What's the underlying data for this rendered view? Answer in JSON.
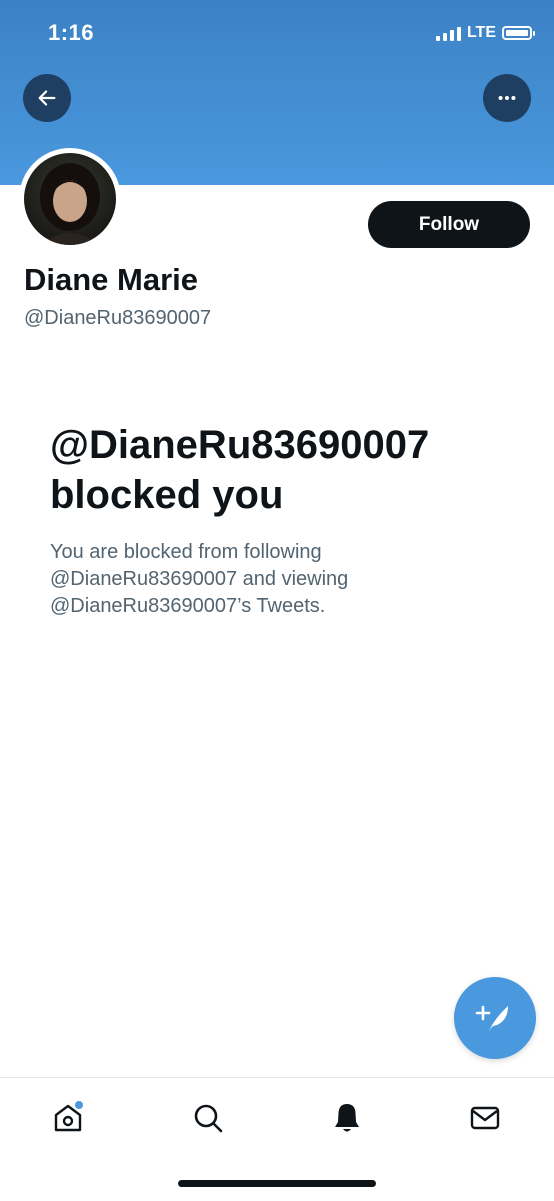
{
  "status_bar": {
    "time": "1:16",
    "network": "LTE",
    "icons": [
      "signal-icon",
      "battery-icon"
    ]
  },
  "header": {
    "back_icon": "arrow-left-icon",
    "more_icon": "more-horizontal-icon"
  },
  "profile": {
    "display_name": "Diane Marie",
    "handle": "@DianeRu83690007",
    "follow_label": "Follow"
  },
  "blocked": {
    "title": "@DianeRu83690007 blocked you",
    "description": "You are blocked from following @DianeRu83690007 and viewing @DianeRu83690007’s Tweets."
  },
  "compose": {
    "icon": "compose-tweet-icon"
  },
  "tab_bar": {
    "items": [
      {
        "name": "home",
        "icon": "home-icon",
        "has_unread": true
      },
      {
        "name": "search",
        "icon": "search-icon"
      },
      {
        "name": "notifications",
        "icon": "bell-icon",
        "active": true
      },
      {
        "name": "messages",
        "icon": "mail-icon"
      }
    ]
  },
  "colors": {
    "banner": "#4a98de",
    "accent": "#4a98de",
    "text_primary": "#0f1419",
    "text_secondary": "#536471"
  }
}
